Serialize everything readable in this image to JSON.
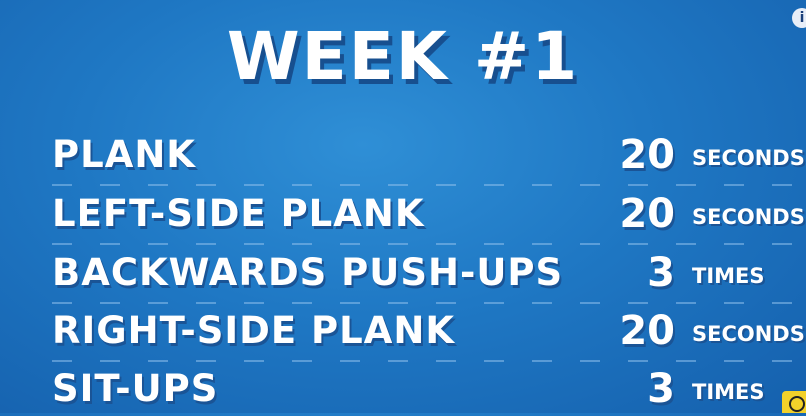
{
  "title": "WEEK #1",
  "exercises": [
    {
      "name": "PLANK",
      "amount": "20",
      "unit": "SECONDS"
    },
    {
      "name": "LEFT-SIDE PLANK",
      "amount": "20",
      "unit": "SECONDS"
    },
    {
      "name": "BACKWARDS PUSH-UPS",
      "amount": "3",
      "unit": "TIMES"
    },
    {
      "name": "RIGHT-SIDE PLANK",
      "amount": "20",
      "unit": "SECONDS"
    },
    {
      "name": "SIT-UPS",
      "amount": "3",
      "unit": "TIMES"
    }
  ],
  "overlay": {
    "info_icon": "i",
    "bulb_icon": "lightbulb-icon"
  }
}
